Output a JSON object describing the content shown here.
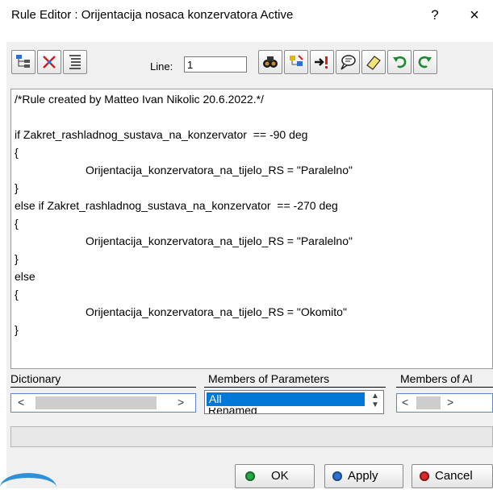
{
  "window": {
    "title": "Rule Editor : Orijentacija nosaca konzervatora Active",
    "help_label": "?",
    "close_label": "×"
  },
  "toolbar": {
    "line_label": "Line:",
    "line_value": "1",
    "icons": [
      "tree-icon",
      "filter-icon",
      "text-align-icon",
      "find-icon",
      "browse-icon",
      "goto-error-icon",
      "comment-icon",
      "erase-icon",
      "undo-icon",
      "redo-icon"
    ]
  },
  "editor": {
    "lines": [
      "/*Rule created by Matteo Ivan Nikolic 20.6.2022.*/",
      "",
      "if Zakret_rashladnog_sustava_na_konzervator  == -90 deg",
      "{",
      "Orijentacija_konzervatora_na_tijelo_RS = \"Paralelno\"",
      "}",
      "else if Zakret_rashladnog_sustava_na_konzervator  == -270 deg",
      "{",
      "Orijentacija_konzervatora_na_tijelo_RS = \"Paralelno\"",
      "}",
      "else",
      "{",
      "Orijentacija_konzervatora_na_tijelo_RS = \"Okomito\"",
      "}"
    ]
  },
  "bottom": {
    "dictionary_label": "Dictionary",
    "members_params_label": "Members of Parameters",
    "members_all_label": "Members of Al",
    "members_params_selected": "All",
    "members_params_next": "Renamed"
  },
  "buttons": {
    "ok": "OK",
    "apply": "Apply",
    "cancel": "Cancel"
  },
  "colors": {
    "ok_dot": "#28a745",
    "apply_dot": "#2f6fd0",
    "cancel_dot": "#d92b2b",
    "selection": "#0078d7"
  }
}
